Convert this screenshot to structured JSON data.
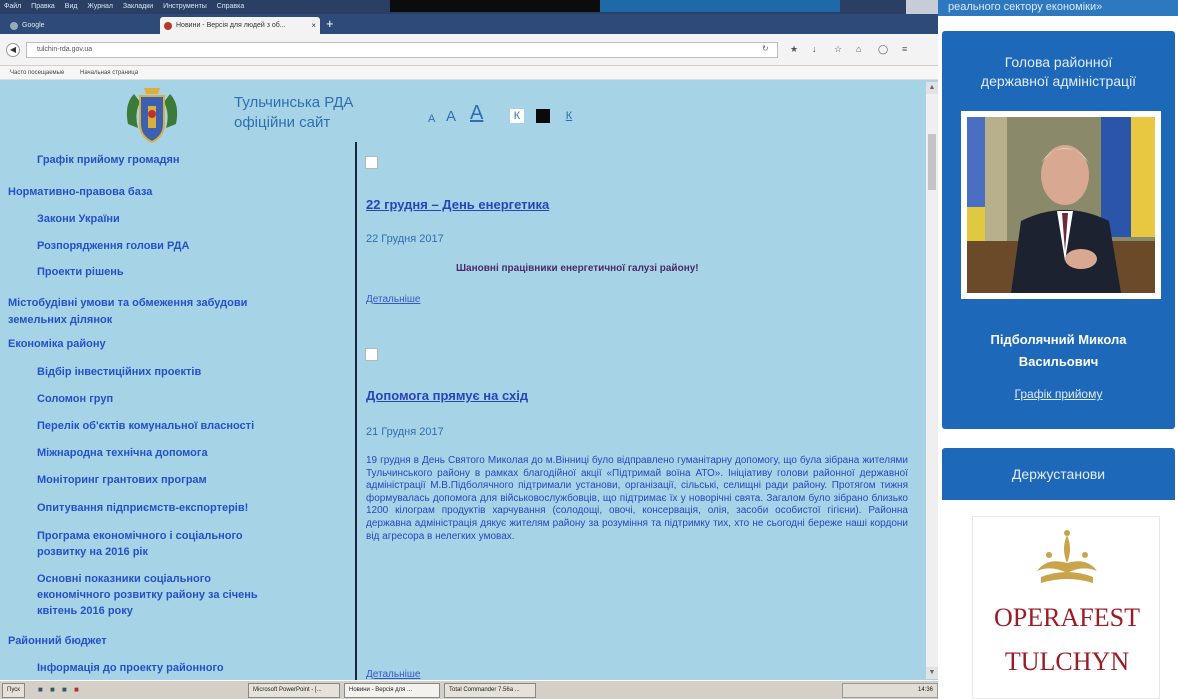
{
  "browser": {
    "menu": [
      "Файл",
      "Правка",
      "Вид",
      "Журнал",
      "Закладки",
      "Инструменты",
      "Справка"
    ],
    "tab1_title": "Google",
    "tab2_title": "Новини - Версія для людей з об...",
    "tab_close": "×",
    "new_tab": "+",
    "url": "tulchin-rda.gov.ua",
    "bookmarks": [
      "Часто посещаемые",
      "Начальная страница"
    ]
  },
  "site": {
    "title": "Тульчинська РДА",
    "subtitle": "офіційни сайт",
    "font_small": "A",
    "font_medium": "A",
    "font_large": "A",
    "contrast_1": "К",
    "contrast_3": "К"
  },
  "nav": [
    {
      "label": "Графік прийому громадян",
      "level": 2
    },
    {
      "label": "Нормативно-правова база",
      "level": 1
    },
    {
      "label": "Закони України",
      "level": 2
    },
    {
      "label": "Розпорядження голови РДА",
      "level": 2
    },
    {
      "label": "Проекти рішень",
      "level": 2
    },
    {
      "label": "Містобудівні умови та обмеження забудови",
      "level": 1
    },
    {
      "label": "земельних ділянок",
      "level": 1
    },
    {
      "label": "Економіка району",
      "level": 1
    },
    {
      "label": "Відбір інвестиційних проектів",
      "level": 2
    },
    {
      "label": "Соломон груп",
      "level": 2
    },
    {
      "label": "Перелік об'єктів комунальної власності",
      "level": 2
    },
    {
      "label": "Міжнародна технічна допомога",
      "level": 2
    },
    {
      "label": "Моніторинг грантових програм",
      "level": 2
    },
    {
      "label": "Опитування підприємств-експортерів!",
      "level": 2
    },
    {
      "label": "Програма економічного і соціального",
      "level": 2
    },
    {
      "label": "розвитку на 2016 рік",
      "level": 2
    },
    {
      "label": "Основні показники соціального",
      "level": 2
    },
    {
      "label": "економічного розвитку району за січень",
      "level": 2
    },
    {
      "label": "квітень 2016 року",
      "level": 2
    },
    {
      "label": "Районний бюджет",
      "level": 1
    },
    {
      "label": "Інформація до проекту районного",
      "level": 2
    }
  ],
  "articles": [
    {
      "title": "22 грудня – День енергетика",
      "date": "22 Грудня 2017",
      "lead": "Шановні працівники енергетичної галузі району!",
      "more": "Детальніше"
    },
    {
      "title": "Допомога прямує на схід",
      "date": "21 Грудня 2017",
      "body": "19 грудня в День Святого Миколая до м.Вінниці було відправлено гуманітарну допомогу, що була зібрана жителями Тульчинського району в рамках благодійної акції «Підтримай воїна АТО». Ініціативу голови районної державної адміністрації М.В.Підболячного підтримали установи, організації, сільські, селищні ради району. Протягом тижня формувалась допомога для військовослужбовців, що підтримає їх у новорічні свята. Загалом було зібрано близько 1200 кілограм продуктів харчування (солодощі, овочі, консервація, олія, засоби особистої гігієни). Районна державна адміністрація дякує жителям району за розуміння та підтримку тих, хто не сьогодні береже наші кордони від агресора в нелегких умовах.",
      "more": "Детальніше"
    }
  ],
  "taskbar": {
    "start": "Пуск",
    "items": [
      "Microsoft PowerPoint - [...",
      "Новини - Версія для ...",
      "Total Commander 7.56a ..."
    ],
    "clock": "14:36"
  },
  "sidebar": {
    "top_text": "реального сектору економіки»",
    "head_title_line1": "Голова районної",
    "head_title_line2": "державної адміністрації",
    "head_name_line1": "Підболячний Микола",
    "head_name_line2": "Васильович",
    "head_link": "Графік прийому",
    "institutions_title": "Держустанови",
    "logo_line1": "OPERAFEST",
    "logo_line2": "TULCHYN"
  },
  "colors": {
    "page_bg": "#a6d4e6",
    "link_blue": "#2550c8",
    "sidebar_blue": "#1d68b8"
  }
}
